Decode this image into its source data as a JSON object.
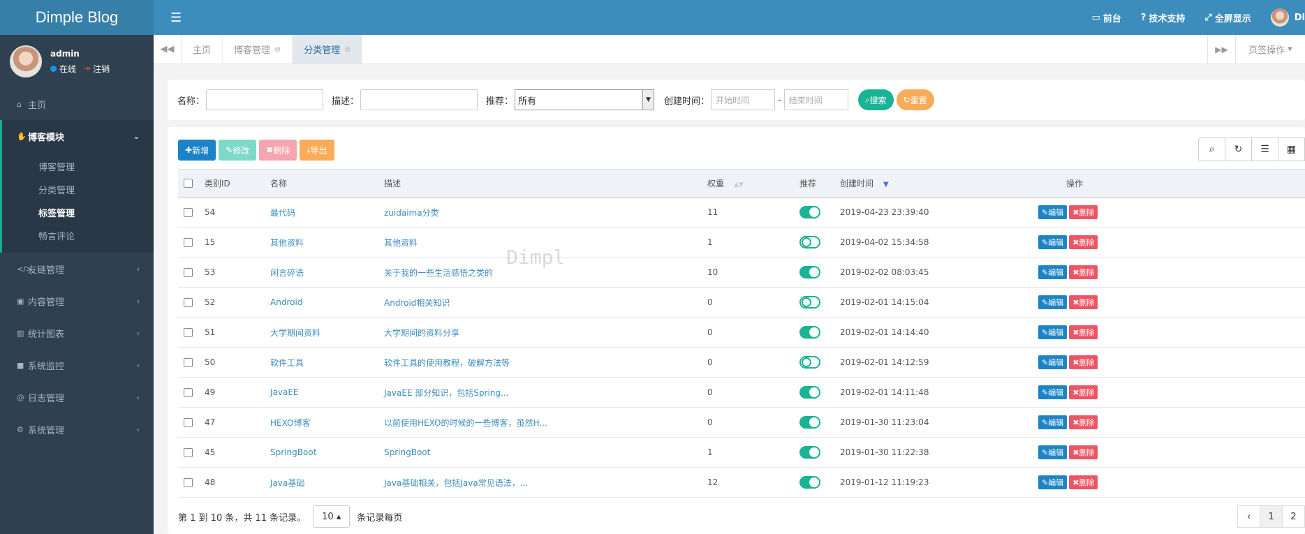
{
  "brand": "Dimple Blog",
  "user": {
    "name": "admin",
    "status": "在线",
    "logout": "注销"
  },
  "sidebar": {
    "items": [
      {
        "icon": "home-icon",
        "glyph": "⌂",
        "label": "主页"
      },
      {
        "icon": "hand-icon",
        "glyph": "✋",
        "label": "博客模块",
        "expanded": true,
        "children": [
          "博客管理",
          "分类管理",
          "标签管理",
          "畅言评论"
        ]
      },
      {
        "icon": "code-icon",
        "glyph": "</>",
        "label": "友链管理"
      },
      {
        "icon": "box-icon",
        "glyph": "▣",
        "label": "内容管理"
      },
      {
        "icon": "bar-chart-icon",
        "glyph": "▥",
        "label": "统计图表"
      },
      {
        "icon": "camera-icon",
        "glyph": "■",
        "label": "系统监控"
      },
      {
        "icon": "at-icon",
        "glyph": "@",
        "label": "日志管理"
      },
      {
        "icon": "cog-icon",
        "glyph": "⚙",
        "label": "系统管理"
      }
    ]
  },
  "topbar": {
    "links": [
      "前台",
      "技术支持",
      "全屏显示"
    ],
    "user_short": "Di"
  },
  "tabs": {
    "items": [
      "主页",
      "博客管理",
      "分类管理"
    ],
    "active": 2,
    "ops": "页签操作"
  },
  "search": {
    "name_label": "名称：",
    "desc_label": "描述：",
    "recommend_label": "推荐：",
    "recommend_value": "所有",
    "created_label": "创建时间：",
    "start_placeholder": "开始时间",
    "end_placeholder": "结束时间",
    "search_btn": "搜索",
    "reset_btn": "重置"
  },
  "toolbar": {
    "add": "新增",
    "edit": "修改",
    "delete": "删除",
    "export": "导出"
  },
  "table": {
    "headers": [
      "类别ID",
      "名称",
      "描述",
      "权重",
      "推荐",
      "创建时间",
      "操作"
    ],
    "rows": [
      {
        "id": "54",
        "name": "最代码",
        "desc": "zuidaima分类",
        "weight": "11",
        "recommend": true,
        "created": "2019-04-23 23:39:40"
      },
      {
        "id": "15",
        "name": "其他资料",
        "desc": "其他资料",
        "weight": "1",
        "recommend": false,
        "created": "2019-04-02 15:34:58"
      },
      {
        "id": "53",
        "name": "闲言碎语",
        "desc": "关于我的一些生活感悟之类的",
        "weight": "10",
        "recommend": true,
        "created": "2019-02-02 08:03:45"
      },
      {
        "id": "52",
        "name": "Android",
        "desc": "Android相关知识",
        "weight": "0",
        "recommend": false,
        "created": "2019-02-01 14:15:04"
      },
      {
        "id": "51",
        "name": "大学期间资料",
        "desc": "大学期间的资料分享",
        "weight": "0",
        "recommend": true,
        "created": "2019-02-01 14:14:40"
      },
      {
        "id": "50",
        "name": "软件工具",
        "desc": "软件工具的使用教程，破解方法等",
        "weight": "0",
        "recommend": false,
        "created": "2019-02-01 14:12:59"
      },
      {
        "id": "49",
        "name": "JavaEE",
        "desc": "JavaEE 部分知识，包括Spring...",
        "weight": "0",
        "recommend": true,
        "created": "2019-02-01 14:11:48"
      },
      {
        "id": "47",
        "name": "HEXO博客",
        "desc": "以前使用HEXO的时候的一些博客，虽然H...",
        "weight": "0",
        "recommend": true,
        "created": "2019-01-30 11:23:04"
      },
      {
        "id": "45",
        "name": "SpringBoot",
        "desc": "SpringBoot",
        "weight": "1",
        "recommend": true,
        "created": "2019-01-30 11:22:38"
      },
      {
        "id": "48",
        "name": "Java基础",
        "desc": "Java基础相关，包括Java常见语法，...",
        "weight": "12",
        "recommend": true,
        "created": "2019-01-12 11:19:23"
      }
    ],
    "edit_label": "编辑",
    "delete_label": "删除"
  },
  "footer": {
    "summary": "第 1 到 10 条，共 11 条记录。",
    "page_size": "10",
    "per_page": "条记录每页",
    "pages": [
      "‹",
      "1",
      "2"
    ]
  },
  "watermark": "Dimpl",
  "colors": {
    "primary": "#3c8dbc",
    "sidebar": "#2f4050",
    "success": "#1ab394",
    "danger": "#ed5565",
    "warning": "#f8ac59"
  }
}
